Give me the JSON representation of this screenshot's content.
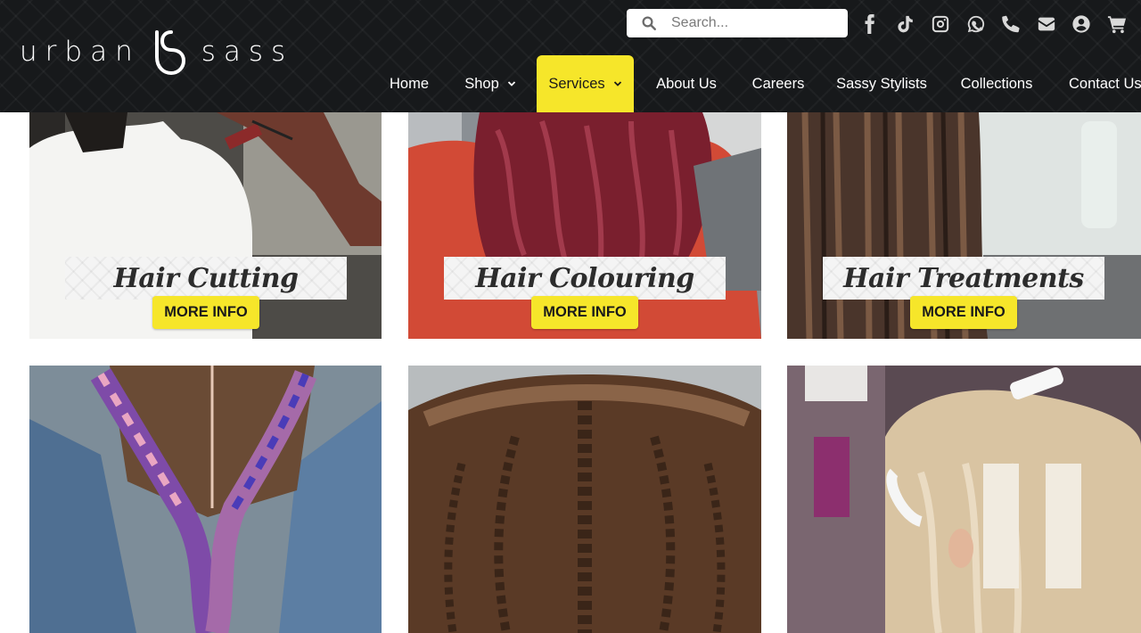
{
  "header": {
    "logo": {
      "left_word": "urban",
      "right_word": "sass"
    },
    "search": {
      "placeholder": "Search..."
    },
    "social_icons": [
      "facebook-icon",
      "tiktok-icon",
      "instagram-icon",
      "whatsapp-icon",
      "phone-icon",
      "email-icon",
      "account-icon",
      "cart-icon"
    ],
    "nav": [
      {
        "label": "Home"
      },
      {
        "label": "Shop",
        "has_dropdown": true
      },
      {
        "label": "Services",
        "has_dropdown": true,
        "active": true
      },
      {
        "label": "About Us"
      },
      {
        "label": "Careers"
      },
      {
        "label": "Sassy Stylists"
      },
      {
        "label": "Collections"
      },
      {
        "label": "Contact Us"
      }
    ]
  },
  "cards": [
    {
      "title": "Hair Cutting",
      "button": "MORE INFO"
    },
    {
      "title": "Hair Colouring",
      "button": "MORE INFO"
    },
    {
      "title": "Hair Treatments",
      "button": "MORE INFO"
    },
    {
      "title": "",
      "button": ""
    },
    {
      "title": "",
      "button": ""
    },
    {
      "title": "",
      "button": ""
    }
  ],
  "colors": {
    "header_bg": "#17191b",
    "accent_yellow": "#f6e62a",
    "nav_text": "#ffffff",
    "icon_gray": "#d9d9d9"
  }
}
